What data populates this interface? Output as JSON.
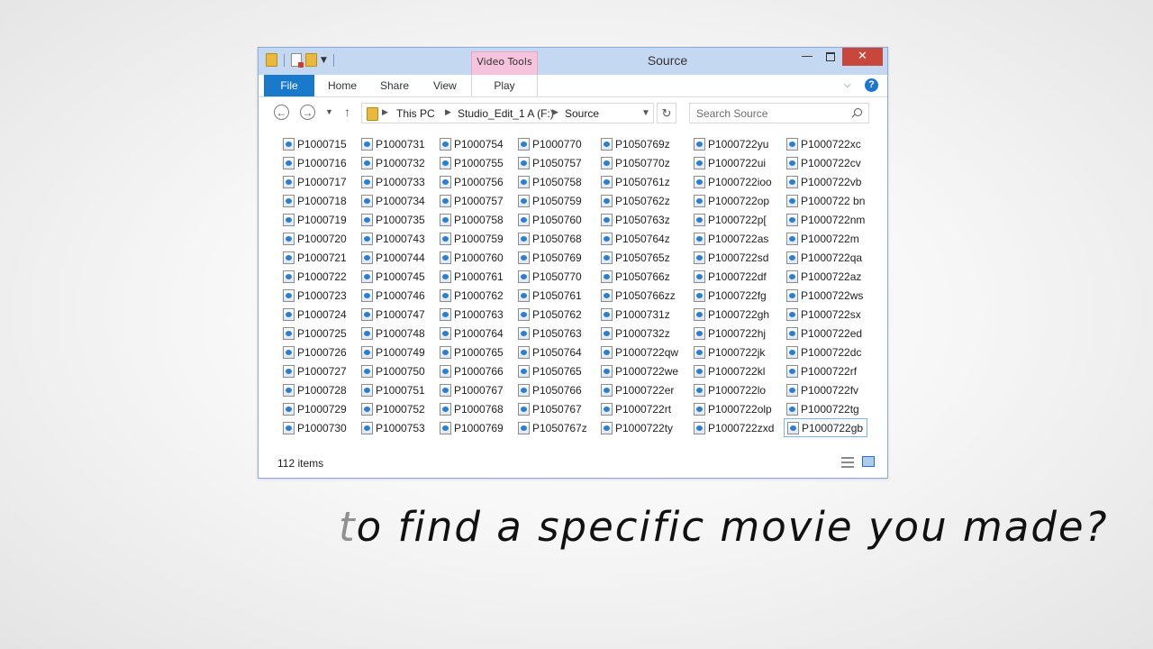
{
  "window": {
    "title": "Source",
    "context_tab": "Video Tools",
    "minimize_glyph": "—",
    "close_glyph": "✕"
  },
  "ribbon": {
    "tabs": [
      "File",
      "Home",
      "Share",
      "View",
      "Play"
    ],
    "active_tab": "File",
    "help_glyph": "?"
  },
  "address": {
    "crumbs": [
      "This PC",
      "Studio_Edit_1 A (F:)",
      "Source"
    ]
  },
  "search": {
    "placeholder": "Search Source"
  },
  "columns": [
    [
      "P1000715",
      "P1000716",
      "P1000717",
      "P1000718",
      "P1000719",
      "P1000720",
      "P1000721",
      "P1000722",
      "P1000723",
      "P1000724",
      "P1000725",
      "P1000726",
      "P1000727",
      "P1000728",
      "P1000729",
      "P1000730"
    ],
    [
      "P1000731",
      "P1000732",
      "P1000733",
      "P1000734",
      "P1000735",
      "P1000743",
      "P1000744",
      "P1000745",
      "P1000746",
      "P1000747",
      "P1000748",
      "P1000749",
      "P1000750",
      "P1000751",
      "P1000752",
      "P1000753"
    ],
    [
      "P1000754",
      "P1000755",
      "P1000756",
      "P1000757",
      "P1000758",
      "P1000759",
      "P1000760",
      "P1000761",
      "P1000762",
      "P1000763",
      "P1000764",
      "P1000765",
      "P1000766",
      "P1000767",
      "P1000768",
      "P1000769"
    ],
    [
      "P1000770",
      "P1050757",
      "P1050758",
      "P1050759",
      "P1050760",
      "P1050768",
      "P1050769",
      "P1050770",
      "P1050761",
      "P1050762",
      "P1050763",
      "P1050764",
      "P1050765",
      "P1050766",
      "P1050767",
      "P1050767z"
    ],
    [
      "P1050769z",
      "P1050770z",
      "P1050761z",
      "P1050762z",
      "P1050763z",
      "P1050764z",
      "P1050765z",
      "P1050766z",
      "P1050766zz",
      "P1000731z",
      "P1000732z",
      "P1000722qw",
      "P1000722we",
      "P1000722er",
      "P1000722rt",
      "P1000722ty"
    ],
    [
      "P1000722yu",
      "P1000722ui",
      "P1000722ioo",
      "P1000722op",
      "P1000722p[",
      "P1000722as",
      "P1000722sd",
      "P1000722df",
      "P1000722fg",
      "P1000722gh",
      "P1000722hj",
      "P1000722jk",
      "P1000722kl",
      "P1000722lo",
      "P1000722olp",
      "P1000722zxd"
    ],
    [
      "P1000722xc",
      "P1000722cv",
      "P1000722vb",
      "P1000722 bn",
      "P1000722nm",
      "P1000722m",
      "P1000722qa",
      "P1000722az",
      "P1000722ws",
      "P1000722sx",
      "P1000722ed",
      "P1000722dc",
      "P1000722rf",
      "P1000722fv",
      "P1000722tg",
      "P1000722gb"
    ]
  ],
  "selected_file": "P1000722gb",
  "status": {
    "item_count": "112 items"
  },
  "caption": {
    "first_letter": "t",
    "rest": "o find a specific movie you made?"
  },
  "colors": {
    "accent": "#1979ca",
    "context_tab": "#f5c3dc",
    "close": "#c7473c",
    "titlebar": "#c5d8f1"
  }
}
